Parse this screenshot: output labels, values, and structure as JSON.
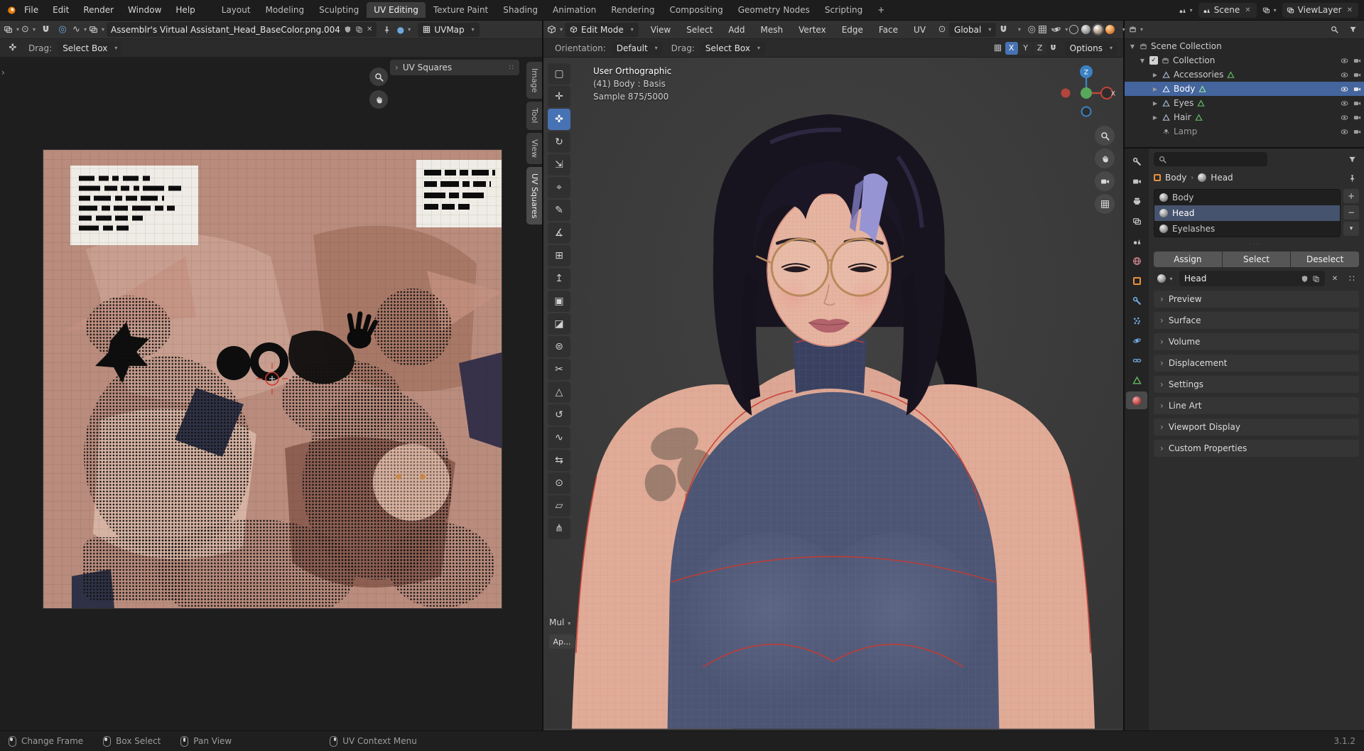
{
  "colors": {
    "accent": "#4772b3",
    "object_orange": "#e8913c",
    "data_green": "#62b862",
    "material_red": "#c24a4a",
    "seam_red": "#c93a30",
    "world_pink": "#d98a93",
    "modifier_blue": "#6fa8dc"
  },
  "icons": {
    "caret_down": "▾",
    "chevron_right": "›",
    "close": "✕",
    "check": "✓",
    "plus": "+",
    "minus": "−",
    "menu_grip": "∷",
    "dots_grip": "····",
    "tool_select_box": "▢",
    "tool_cursor": "✛",
    "tool_move": "✜",
    "tool_rotate": "↻",
    "tool_scale": "⇲",
    "tool_transform": "⌖",
    "tool_annotate": "✎",
    "tool_measure": "∡",
    "tool_add_cube": "⊞",
    "tool_extrude": "↥",
    "tool_inset": "▣",
    "tool_bevel": "◪",
    "tool_loop_cut": "⊜",
    "tool_knife": "✂",
    "tool_poly_build": "△",
    "tool_spin": "↺",
    "tool_smooth": "∿",
    "tool_edge_slide": "⇆",
    "tool_shrink_fatten": "⊙",
    "tool_shear": "▱",
    "tool_rip": "⋔",
    "vertex_mode": "•",
    "edge_mode": "╱",
    "face_mode": "▰",
    "pivot": "⊙",
    "falloff": "∿",
    "prop_edit": "◎"
  },
  "topbar": {
    "menus": [
      "File",
      "Edit",
      "Render",
      "Window",
      "Help"
    ],
    "tabs": [
      "Layout",
      "Modeling",
      "Sculpting",
      "UV Editing",
      "Texture Paint",
      "Shading",
      "Animation",
      "Rendering",
      "Compositing",
      "Geometry Nodes",
      "Scripting"
    ],
    "add_tab": "+",
    "scene_label": "Scene",
    "view_layer_label": "ViewLayer"
  },
  "uv_editor": {
    "image_name": "Assemblr's Virtual Assistant_Head_BaseColor.png.004",
    "uv_map": "UVMap",
    "drag_label": "Drag:",
    "drag_value": "Select Box",
    "panel_label": "UV Squares",
    "side_tabs": [
      "Image",
      "Tool",
      "View",
      "UV Squares"
    ]
  },
  "viewport": {
    "mode": "Edit Mode",
    "menus": [
      "View",
      "Select",
      "Add",
      "Mesh",
      "Vertex",
      "Edge",
      "Face",
      "UV"
    ],
    "transform_space": "Global",
    "orientation_label": "Orientation:",
    "orientation_value": "Default",
    "drag_label": "Drag:",
    "drag_value": "Select Box",
    "axes": [
      "X",
      "Y",
      "Z"
    ],
    "options_label": "Options",
    "overlay_line1": "User Orthographic",
    "overlay_line2": "(41) Body : Basis",
    "overlay_line3": "Sample 875/5000",
    "gizmo_z": "Z",
    "gizmo_x": "X",
    "panel_label": "Mul",
    "apply_label": "Ap..."
  },
  "outliner": {
    "root": "Scene Collection",
    "items": [
      {
        "name": "Collection"
      },
      {
        "name": "Accessories"
      },
      {
        "name": "Body"
      },
      {
        "name": "Eyes"
      },
      {
        "name": "Hair"
      },
      {
        "name": "Lamp"
      }
    ]
  },
  "properties": {
    "breadcrumb_object": "Body",
    "breadcrumb_data": "Head",
    "slots": [
      "Body",
      "Head",
      "Eyelashes"
    ],
    "assign_label": "Assign",
    "select_label": "Select",
    "deselect_label": "Deselect",
    "material_name": "Head",
    "sections": [
      "Preview",
      "Surface",
      "Volume",
      "Displacement",
      "Settings",
      "Line Art",
      "Viewport Display",
      "Custom Properties"
    ]
  },
  "statusbar": {
    "items": [
      "Change Frame",
      "Box Select",
      "Pan View",
      "UV Context Menu"
    ],
    "version": "3.1.2"
  }
}
